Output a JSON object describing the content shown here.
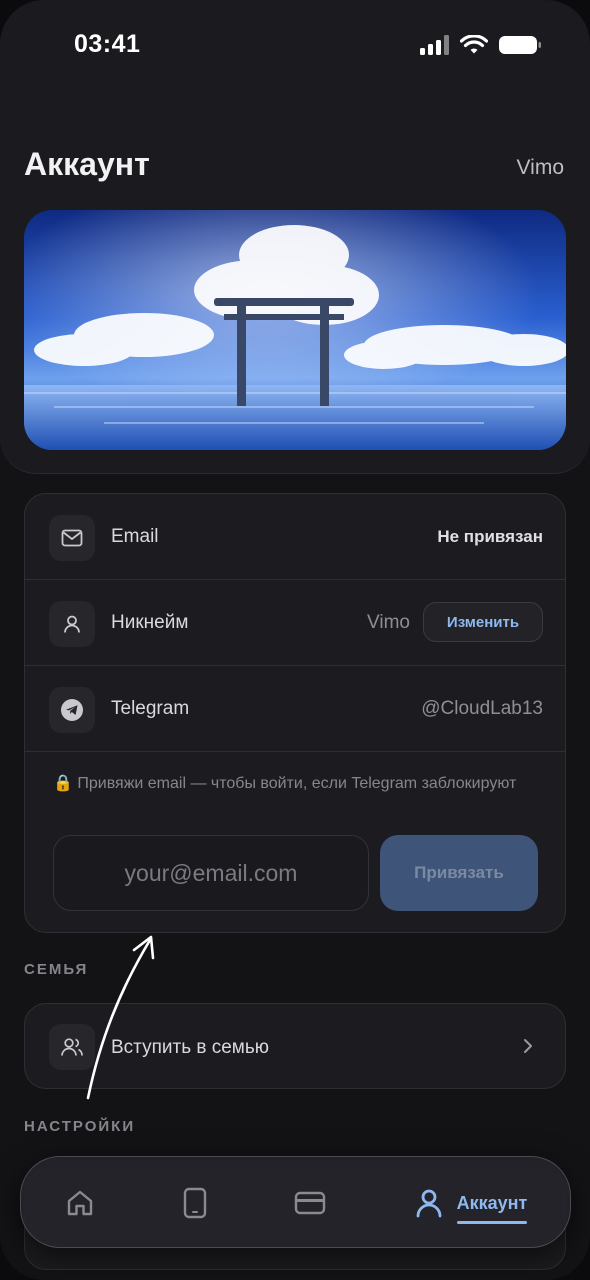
{
  "status_bar": {
    "time": "03:41"
  },
  "header": {
    "title": "Аккаунт",
    "username": "Vimo"
  },
  "account": {
    "email_row": {
      "label": "Email",
      "value": "Не привязан",
      "icon": "mail-icon"
    },
    "nickname_row": {
      "label": "Никнейм",
      "value": "Vimo",
      "edit_label": "Изменить",
      "icon": "user-icon"
    },
    "telegram_row": {
      "label": "Telegram",
      "value": "@CloudLab13",
      "icon": "telegram-icon"
    },
    "hint": "🔒 Привяжи email — чтобы войти, если Telegram заблокируют",
    "email_input": {
      "placeholder": "your@email.com",
      "value": ""
    },
    "bind_label": "Привязать"
  },
  "family": {
    "section_label": "СЕМЬЯ",
    "join_label": "Вступить в семью",
    "icon": "users-icon"
  },
  "settings": {
    "section_label": "НАСТРОЙКИ"
  },
  "tabbar": {
    "items": [
      {
        "icon": "home-icon",
        "label": ""
      },
      {
        "icon": "phone-icon",
        "label": ""
      },
      {
        "icon": "card-icon",
        "label": ""
      },
      {
        "icon": "user-icon",
        "label": "Аккаунт",
        "active": true
      }
    ]
  },
  "colors": {
    "accent": "#8fb8ef",
    "background": "#131316",
    "card": "#1c1c20",
    "bind_button": "#3e5478"
  }
}
